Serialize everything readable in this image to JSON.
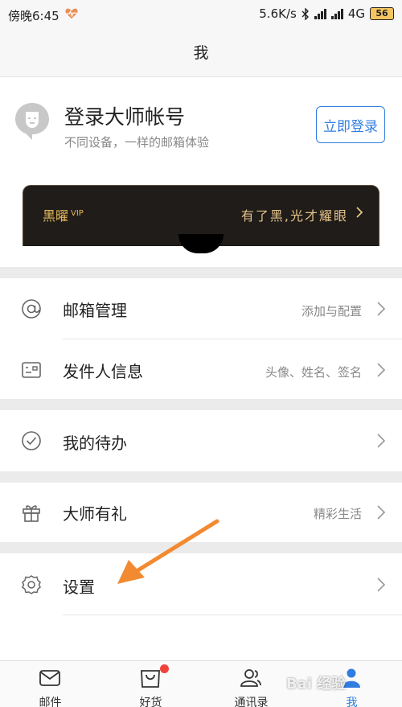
{
  "status_bar": {
    "time": "傍晚6:45",
    "network_speed": "5.6K/s",
    "network_type": "4G",
    "battery": "56",
    "heart_color": "#e98f57"
  },
  "header": {
    "title": "我"
  },
  "account": {
    "title": "登录大师帐号",
    "subtitle": "不同设备，一样的邮箱体验",
    "login_button": "立即登录",
    "accent_color": "#2f7de1"
  },
  "vip": {
    "title": "黑曜",
    "badge": "VIP",
    "slogan": "有了黑,光才耀眼"
  },
  "menu": [
    {
      "label": "邮箱管理",
      "hint": "添加与配置",
      "icon": "at-icon"
    },
    {
      "label": "发件人信息",
      "hint": "头像、姓名、签名",
      "icon": "id-card-icon"
    },
    {
      "label": "我的待办",
      "hint": "",
      "icon": "check-circle-icon"
    },
    {
      "label": "大师有礼",
      "hint": "精彩生活",
      "icon": "gift-icon"
    },
    {
      "label": "设置",
      "hint": "",
      "icon": "gear-icon"
    }
  ],
  "tabs": [
    {
      "label": "邮件",
      "icon": "mail-icon"
    },
    {
      "label": "好货",
      "icon": "shopping-bag-icon"
    },
    {
      "label": "通讯录",
      "icon": "contacts-icon"
    },
    {
      "label": "我",
      "icon": "profile-icon",
      "active": true
    }
  ],
  "annotation": {
    "arrow_color": "#f28a32"
  },
  "watermark": "Bai 经验"
}
